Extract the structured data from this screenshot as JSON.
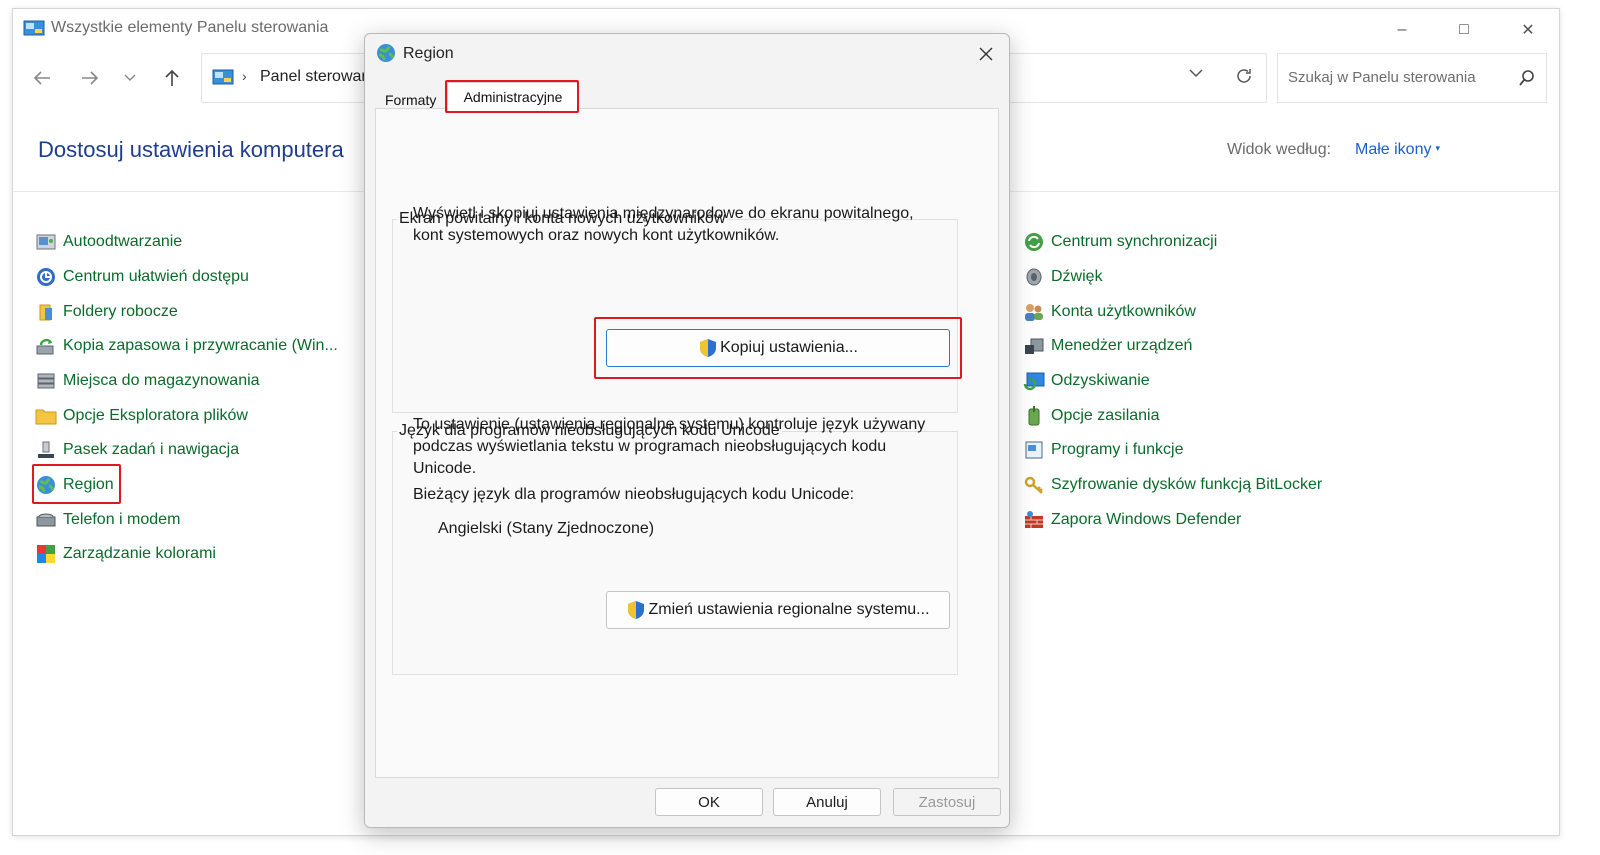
{
  "window": {
    "title": "Wszystkie elementy Panelu sterowania",
    "controls": {
      "minimize": "–",
      "maximize": "□",
      "close": "✕"
    }
  },
  "nav": {
    "address": "Panel sterowania",
    "search_placeholder": "Szukaj w Panelu sterowania"
  },
  "header": {
    "title": "Dostosuj ustawienia komputera",
    "view_label": "Widok według:",
    "view_value": "Małe ikony"
  },
  "left_items": [
    {
      "label": "Autoodtwarzanie",
      "icon": "autoplay-icon"
    },
    {
      "label": "Centrum ułatwień dostępu",
      "icon": "accessibility-icon"
    },
    {
      "label": "Foldery robocze",
      "icon": "work-folders-icon"
    },
    {
      "label": "Kopia zapasowa i przywracanie (Win...",
      "icon": "backup-icon"
    },
    {
      "label": "Miejsca do magazynowania",
      "icon": "storage-spaces-icon"
    },
    {
      "label": "Opcje Eksploratora plików",
      "icon": "folder-options-icon"
    },
    {
      "label": "Pasek zadań i nawigacja",
      "icon": "taskbar-icon"
    },
    {
      "label": "Region",
      "icon": "globe-icon"
    },
    {
      "label": "Telefon i modem",
      "icon": "phone-modem-icon"
    },
    {
      "label": "Zarządzanie kolorami",
      "icon": "color-management-icon"
    }
  ],
  "right_items": [
    {
      "label": "Centrum synchronizacji",
      "icon": "sync-icon"
    },
    {
      "label": "Dźwięk",
      "icon": "speaker-icon"
    },
    {
      "label": "Konta użytkowników",
      "icon": "users-icon"
    },
    {
      "label": "Menedżer urządzeń",
      "icon": "device-manager-icon"
    },
    {
      "label": "Odzyskiwanie",
      "icon": "recovery-icon"
    },
    {
      "label": "Opcje zasilania",
      "icon": "power-icon"
    },
    {
      "label": "Programy i funkcje",
      "icon": "programs-icon"
    },
    {
      "label": "Szyfrowanie dysków funkcją BitLocker",
      "icon": "bitlocker-icon"
    },
    {
      "label": "Zapora Windows Defender",
      "icon": "firewall-icon"
    }
  ],
  "dialog": {
    "title": "Region",
    "close": "✕",
    "tabs": [
      "Formaty",
      "Administracyjne"
    ],
    "group1": {
      "title": "Ekran powitalny i konta nowych użytkowników",
      "line1": "Wyświetl i skopiuj ustawienia międzynarodowe do ekranu powitalnego,",
      "line2": "kont systemowych oraz nowych kont użytkowników.",
      "button": "Kopiuj ustawienia..."
    },
    "group2": {
      "title": "Język dla programów nieobsługujących kodu Unicode",
      "line1": "To ustawienie (ustawienia regionalne systemu) kontroluje język używany",
      "line2": "podczas wyświetlania tekstu w programach nieobsługujących kodu",
      "line3": "Unicode.",
      "current_label": "Bieżący język dla programów nieobsługujących kodu Unicode:",
      "current_value": "Angielski (Stany Zjednoczone)",
      "button": "Zmień ustawienia regionalne systemu..."
    },
    "buttons": {
      "ok": "OK",
      "cancel": "Anuluj",
      "apply": "Zastosuj"
    }
  },
  "colors": {
    "link_green": "#0b6b2a",
    "heading_blue": "#1f3d8f",
    "highlight_red": "#e0191f"
  }
}
